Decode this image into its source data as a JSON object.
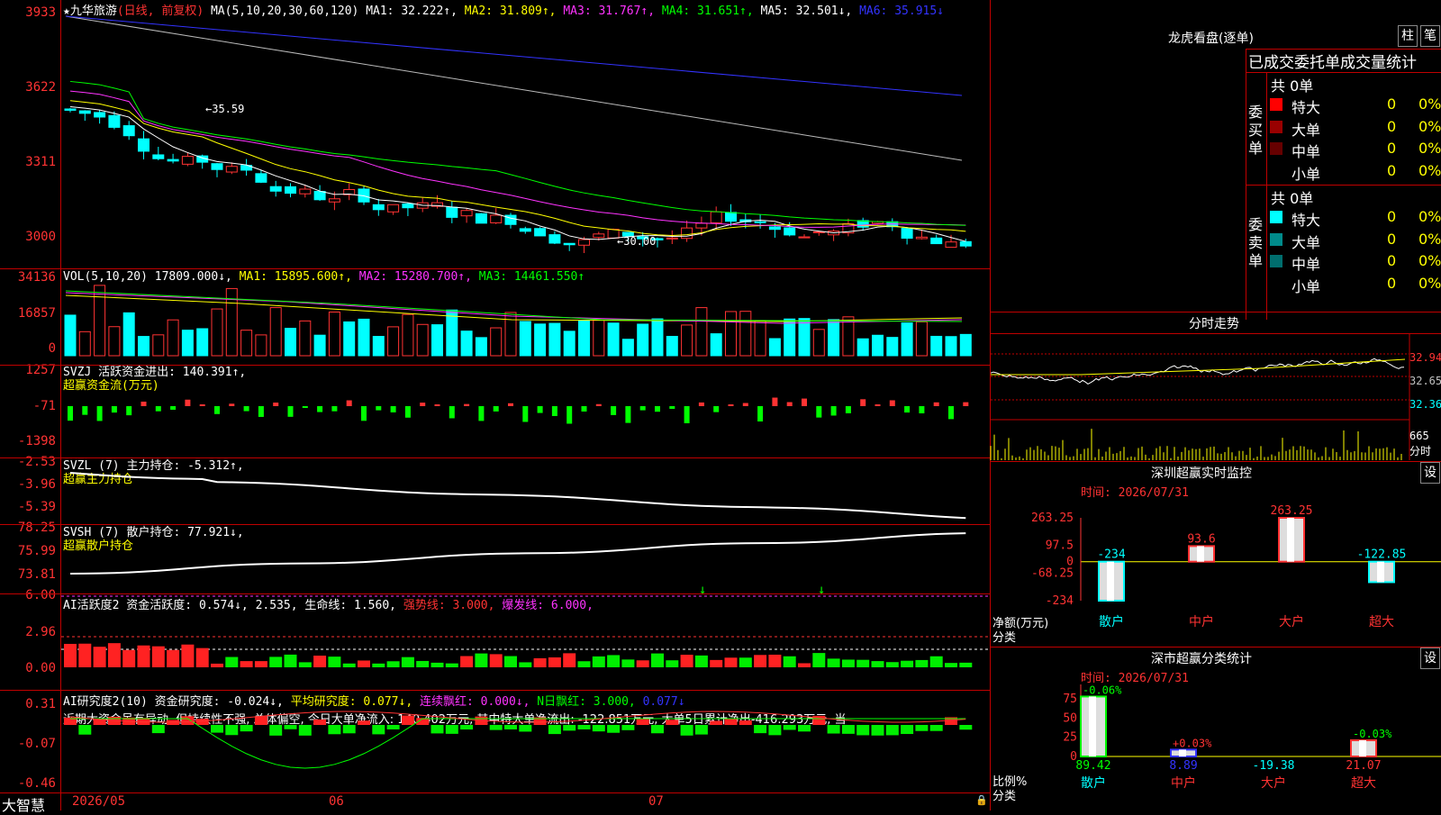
{
  "stock": {
    "name": "九华旅游",
    "mode": "(日线, 前复权)",
    "star": "★"
  },
  "main_header": {
    "ma_label": "MA(5,10,20,30,60,120)",
    "ma1": "MA1: 32.222↑,",
    "ma2": "MA2: 31.809↑,",
    "ma3": "MA3: 31.767↑,",
    "ma4": "MA4: 31.651↑,",
    "ma5": "MA5: 32.501↓,",
    "ma6": "MA6: 35.915↓"
  },
  "main_axis": [
    "3933",
    "3622",
    "3311",
    "3000"
  ],
  "main_annotations": {
    "high": "35.59",
    "low": "30.00"
  },
  "vol_header": {
    "label": "VOL(5,10,20)",
    "value": "17809.000↓,",
    "ma1": "MA1: 15895.600↑,",
    "ma2": "MA2: 15280.700↑,",
    "ma3": "MA3: 14461.550↑"
  },
  "vol_axis": [
    "34136",
    "16857",
    "0"
  ],
  "svzj_header": {
    "line1": "SVZJ  活跃资金进出: 140.391↑,",
    "line2": "超赢资金流(万元)"
  },
  "svzj_axis": [
    "1257",
    "-71",
    "-1398"
  ],
  "svzl_header": {
    "line1": "SVZL (7) 主力持仓: -5.312↑,",
    "line2": "超赢主力持仓"
  },
  "svzl_axis": [
    "-2.53",
    "-3.96",
    "-5.39"
  ],
  "svsh_header": {
    "line1": "SVSH (7) 散户持仓: 77.921↓,",
    "line2": "超赢散户持仓"
  },
  "svsh_axis": [
    "78.25",
    "75.99",
    "73.81"
  ],
  "ai1_header": {
    "a": "AI活跃度2 资金活跃度: 0.574↓,",
    "b": "2.535,",
    "c": "生命线: 1.560,",
    "d": "强势线: 3.000,",
    "e": "爆发线: 6.000,"
  },
  "ai1_axis": [
    "6.00",
    "2.96",
    "0.00"
  ],
  "ai2_header": {
    "a": "AI研究度2(10) 资金研究度: -0.024↓,",
    "b": "平均研究度: 0.077↓,",
    "c": "连续飘红: 0.000↓,",
    "d": "N日飘红: 3.000,",
    "e": "0.077↓"
  },
  "ai2_comment": "近期大资金虽有异动, 但持续性不强, 总体偏空, 今日大单净流入: 140.402万元, 其中特大单净流出: -122.851万元, 大单5日累计净出-416.293万元, 当",
  "ai2_axis": [
    "0.31",
    "-0.07",
    "-0.46"
  ],
  "bottom": {
    "brand": "大智慧",
    "dates": [
      "2026/05",
      "06",
      "07"
    ]
  },
  "longhu": {
    "title": "龙虎看盘(逐单)",
    "btn1": "柱",
    "btn2": "笔",
    "table_header": "已成交委托单成交量统计",
    "buy": {
      "side": "委买单",
      "total": "共 0单",
      "rows": [
        {
          "label": "特大",
          "vol": "0",
          "pct": "0%",
          "color": "#ff0000"
        },
        {
          "label": "大单",
          "vol": "0",
          "pct": "0%",
          "color": "#990000"
        },
        {
          "label": "中单",
          "vol": "0",
          "pct": "0%",
          "color": "#660000"
        },
        {
          "label": "小单",
          "vol": "0",
          "pct": "0%",
          "color": "#000000"
        }
      ]
    },
    "sell": {
      "side": "委卖单",
      "total": "共 0单",
      "rows": [
        {
          "label": "特大",
          "vol": "0",
          "pct": "0%",
          "color": "#00ffff"
        },
        {
          "label": "大单",
          "vol": "0",
          "pct": "0%",
          "color": "#008b8b"
        },
        {
          "label": "中单",
          "vol": "0",
          "pct": "0%",
          "color": "#006e6e"
        },
        {
          "label": "小单",
          "vol": "0",
          "pct": "0%",
          "color": "#000000"
        }
      ]
    }
  },
  "intraday": {
    "title": "分时走势",
    "prices": [
      "32.94",
      "32.65",
      "32.36"
    ],
    "vol": "665",
    "unit": "分时"
  },
  "monitor": {
    "title": "深圳超赢实时监控",
    "btn": "设",
    "time": "时间: 2026/07/31",
    "axis": [
      "263.25",
      "97.5",
      "0",
      "-68.25",
      "-234"
    ],
    "ylabel": "净额(万元)",
    "xlabel": "分类",
    "cats": [
      "散户",
      "中户",
      "大户",
      "超大"
    ]
  },
  "classify": {
    "title": "深市超赢分类统计",
    "btn": "设",
    "time": "时间: 2026/07/31",
    "axis": [
      "75",
      "50",
      "25",
      "0"
    ],
    "ylabel": "比例%",
    "xlabel": "分类",
    "cats": [
      "散户",
      "中户",
      "大户",
      "超大"
    ],
    "pcts": [
      "-0.06%",
      "+0.03%",
      "",
      "-0.03%"
    ]
  },
  "chart_data": [
    {
      "type": "bar",
      "title": "深圳超赢实时监控",
      "categories": [
        "散户",
        "中户",
        "大户",
        "超大"
      ],
      "values": [
        -234,
        93.6,
        263.25,
        -122.85
      ],
      "ylabel": "净额(万元)",
      "ylim": [
        -234,
        263.25
      ]
    },
    {
      "type": "bar",
      "title": "深市超赢分类统计",
      "categories": [
        "散户",
        "中户",
        "大户",
        "超大"
      ],
      "values": [
        89.42,
        8.89,
        -19.38,
        21.07
      ],
      "ylabel": "比例%",
      "ylim": [
        0,
        75
      ]
    }
  ]
}
